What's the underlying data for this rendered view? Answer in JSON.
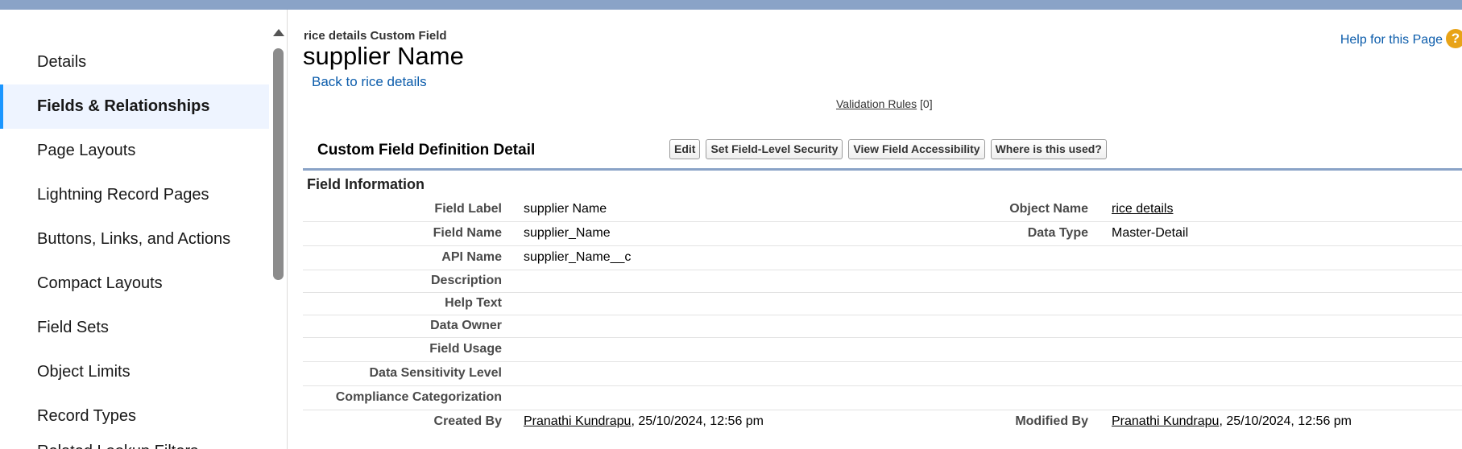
{
  "sidebar": {
    "items": [
      {
        "label": "Details"
      },
      {
        "label": "Fields & Relationships"
      },
      {
        "label": "Page Layouts"
      },
      {
        "label": "Lightning Record Pages"
      },
      {
        "label": "Buttons, Links, and Actions"
      },
      {
        "label": "Compact Layouts"
      },
      {
        "label": "Field Sets"
      },
      {
        "label": "Object Limits"
      },
      {
        "label": "Record Types"
      },
      {
        "label": "Related Lookup Filters"
      }
    ]
  },
  "header": {
    "breadcrumb": "rice details Custom Field",
    "title": "supplier Name",
    "back_link": "Back to rice details",
    "help_link": "Help for this Page",
    "help_icon": "?"
  },
  "validation": {
    "label": "Validation Rules",
    "count": "[0]"
  },
  "detail": {
    "title": "Custom Field Definition Detail",
    "buttons": {
      "edit": "Edit",
      "security": "Set Field-Level Security",
      "accessibility": "View Field Accessibility",
      "where_used": "Where is this used?"
    },
    "section_title": "Field Information"
  },
  "fields": {
    "field_label": {
      "label": "Field Label",
      "value": "supplier Name"
    },
    "object_name": {
      "label": "Object Name",
      "value": "rice details"
    },
    "field_name": {
      "label": "Field Name",
      "value": "supplier_Name"
    },
    "data_type": {
      "label": "Data Type",
      "value": "Master-Detail"
    },
    "api_name": {
      "label": "API Name",
      "value": "supplier_Name__c"
    },
    "description": {
      "label": "Description",
      "value": ""
    },
    "help_text": {
      "label": "Help Text",
      "value": ""
    },
    "data_owner": {
      "label": "Data Owner",
      "value": ""
    },
    "field_usage": {
      "label": "Field Usage",
      "value": ""
    },
    "data_sensitivity": {
      "label": "Data Sensitivity Level",
      "value": ""
    },
    "compliance": {
      "label": "Compliance Categorization",
      "value": ""
    },
    "created_by": {
      "label": "Created By",
      "user": "Pranathi Kundrapu",
      "date": ", 25/10/2024, 12:56 pm"
    },
    "modified_by": {
      "label": "Modified By",
      "user": "Pranathi Kundrapu",
      "date": ", 25/10/2024, 12:56 pm"
    }
  }
}
